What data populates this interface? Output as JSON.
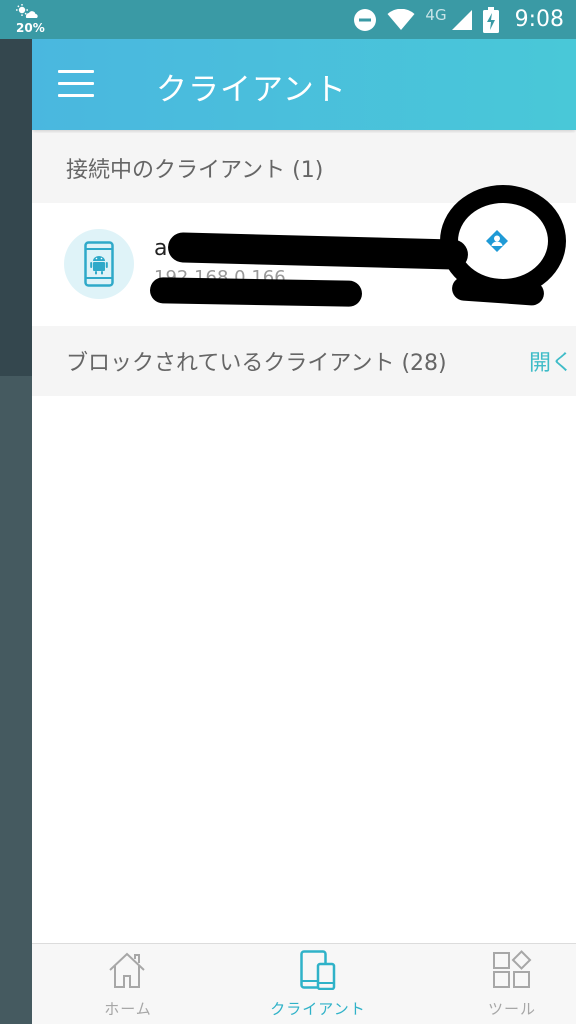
{
  "status_bar": {
    "weather_icon": "weather-icon",
    "battery_level": "20%",
    "network_type": "4G",
    "time": "9:08"
  },
  "app_bar": {
    "title": "クライアント",
    "menu_icon": "hamburger-menu-icon",
    "color": "#49c8d8"
  },
  "connected_section": {
    "label": "接続中のクライアント (1)"
  },
  "clients": [
    {
      "name": "a",
      "ip": "192.168.0.166",
      "device_icon": "android-phone-icon",
      "action_icon": "person-icon"
    }
  ],
  "blocked_section": {
    "label": "ブロックされているクライアント (28)",
    "open_link": "開く"
  },
  "bottom_nav": {
    "items": [
      {
        "label": "ホーム",
        "icon": "home-icon",
        "active": false
      },
      {
        "label": "クライアント",
        "icon": "clients-device-icon",
        "active": true
      },
      {
        "label": "ツール",
        "icon": "tools-grid-icon",
        "active": false
      }
    ],
    "active_color": "#2fb2c8",
    "inactive_color": "#a7a7a7"
  }
}
